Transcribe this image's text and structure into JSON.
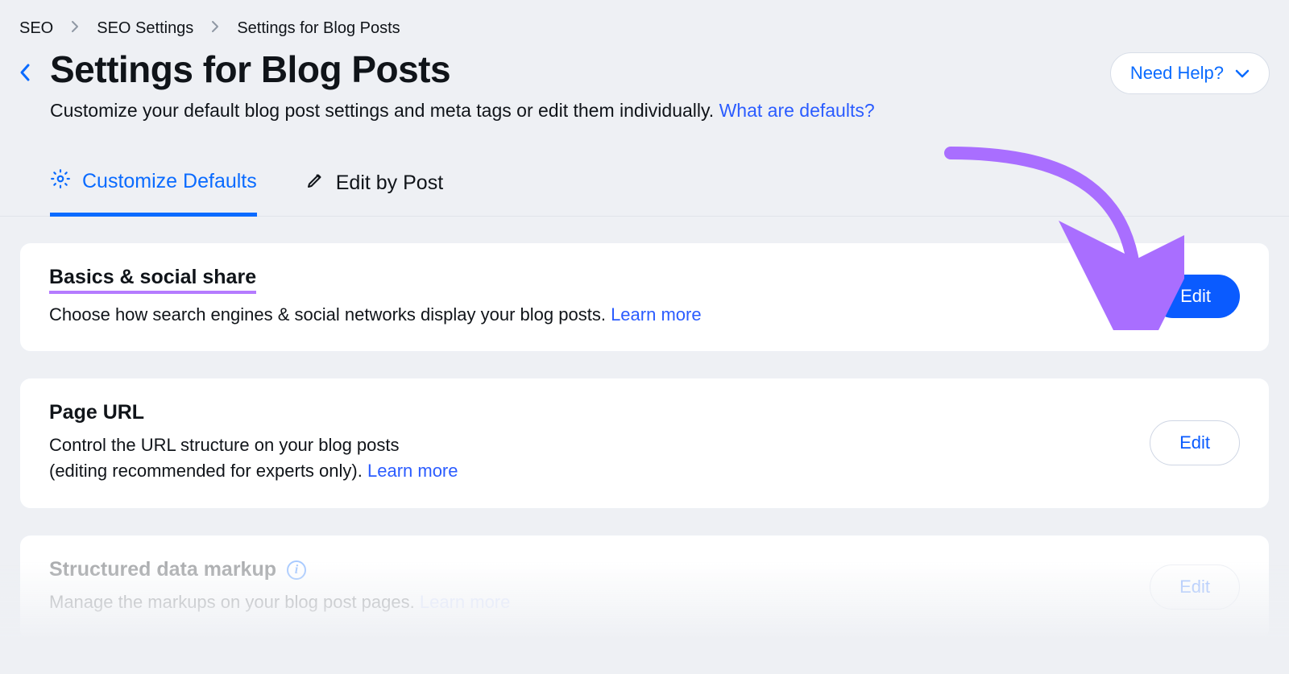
{
  "breadcrumb": {
    "item1": "SEO",
    "item2": "SEO Settings",
    "item3": "Settings for Blog Posts"
  },
  "header": {
    "title": "Settings for Blog Posts",
    "subtitle": "Customize your default blog post settings and meta tags or edit them individually.",
    "subtitle_link": "What are defaults?",
    "need_help": "Need Help?"
  },
  "tabs": {
    "customize": "Customize Defaults",
    "edit_by_post": "Edit by Post"
  },
  "cards": {
    "basics": {
      "title": "Basics & social share",
      "desc": "Choose how search engines & social networks display your blog posts.",
      "learn_more": "Learn more",
      "edit": "Edit"
    },
    "page_url": {
      "title": "Page URL",
      "desc_line1": "Control the URL structure on your blog posts",
      "desc_line2": "(editing recommended for experts only).",
      "learn_more": "Learn more",
      "edit": "Edit"
    },
    "structured": {
      "title": "Structured data markup",
      "desc": "Manage the markups on your blog post pages.",
      "learn_more": "Learn more",
      "edit": "Edit"
    }
  }
}
